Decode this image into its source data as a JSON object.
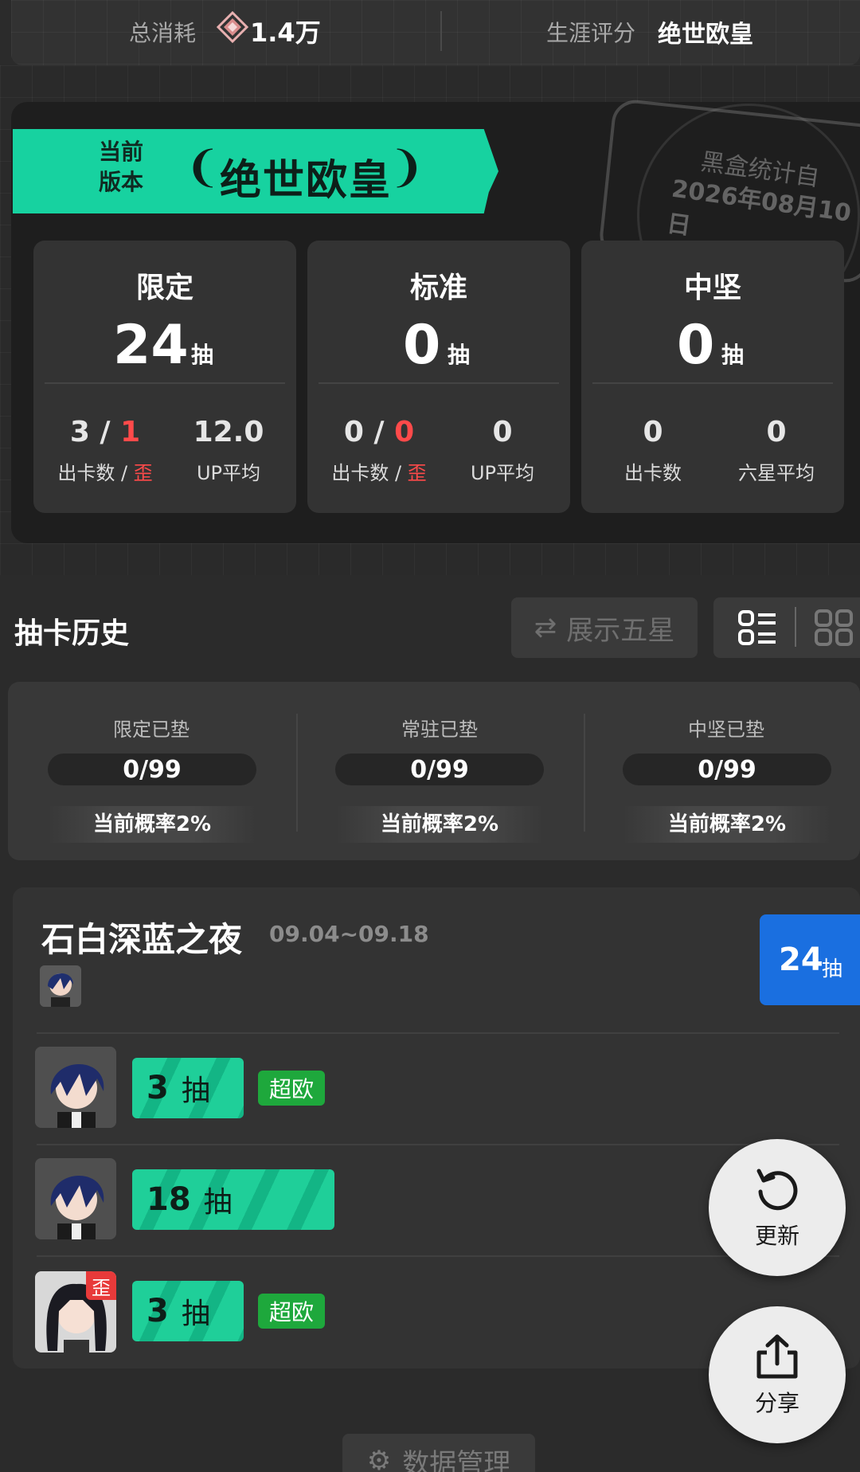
{
  "summary": {
    "total_cost_label": "总消耗",
    "total_cost_value": "1.4万",
    "career_label": "生涯评分",
    "career_value": "绝世欧皇"
  },
  "current": {
    "label_line1": "当前",
    "label_line2": "版本",
    "rating": "绝世欧皇",
    "stamp_line1": "黑盒统计自",
    "stamp_line2": "2026年08月10日"
  },
  "stats": [
    {
      "title": "限定",
      "count": "24",
      "unit": "抽",
      "v1a": "3 / ",
      "v1b": "1",
      "s1a": "出卡数 / ",
      "s1b": "歪",
      "v2": "12.0",
      "s2": "UP平均"
    },
    {
      "title": "标准",
      "count": "0",
      "unit": "抽",
      "v1a": "0 / ",
      "v1b": "0",
      "s1a": "出卡数 / ",
      "s1b": "歪",
      "v2": "0",
      "s2": "UP平均"
    },
    {
      "title": "中坚",
      "count": "0",
      "unit": "抽",
      "v1a": "0",
      "v1b": "",
      "s1a": "出卡数",
      "s1b": "",
      "v2": "0",
      "s2": "六星平均"
    }
  ],
  "history": {
    "title": "抽卡历史",
    "show_five_star": "展示五星",
    "data_manage": "数据管理"
  },
  "pity": [
    {
      "label": "限定已垫",
      "value": "0/99",
      "rate": "当前概率2%"
    },
    {
      "label": "常驻已垫",
      "value": "0/99",
      "rate": "当前概率2%"
    },
    {
      "label": "中坚已垫",
      "value": "0/99",
      "rate": "当前概率2%"
    }
  ],
  "record": {
    "banner_name": "石白深蓝之夜",
    "date_range": "09.04~09.18",
    "total": "24",
    "total_unit": "抽",
    "rows": [
      {
        "pulls": "3",
        "unit": "抽",
        "tag": "超欧"
      },
      {
        "pulls": "18",
        "unit": "抽",
        "tag": ""
      },
      {
        "pulls": "3",
        "unit": "抽",
        "tag": "超欧",
        "off_banner": "歪"
      }
    ]
  },
  "fab": {
    "refresh": "更新",
    "share": "分享"
  },
  "colors": {
    "accent_green": "#17d2a0",
    "blue": "#1a6fe0",
    "red": "#ff4a4a",
    "tag_green": "#1ea83c"
  }
}
